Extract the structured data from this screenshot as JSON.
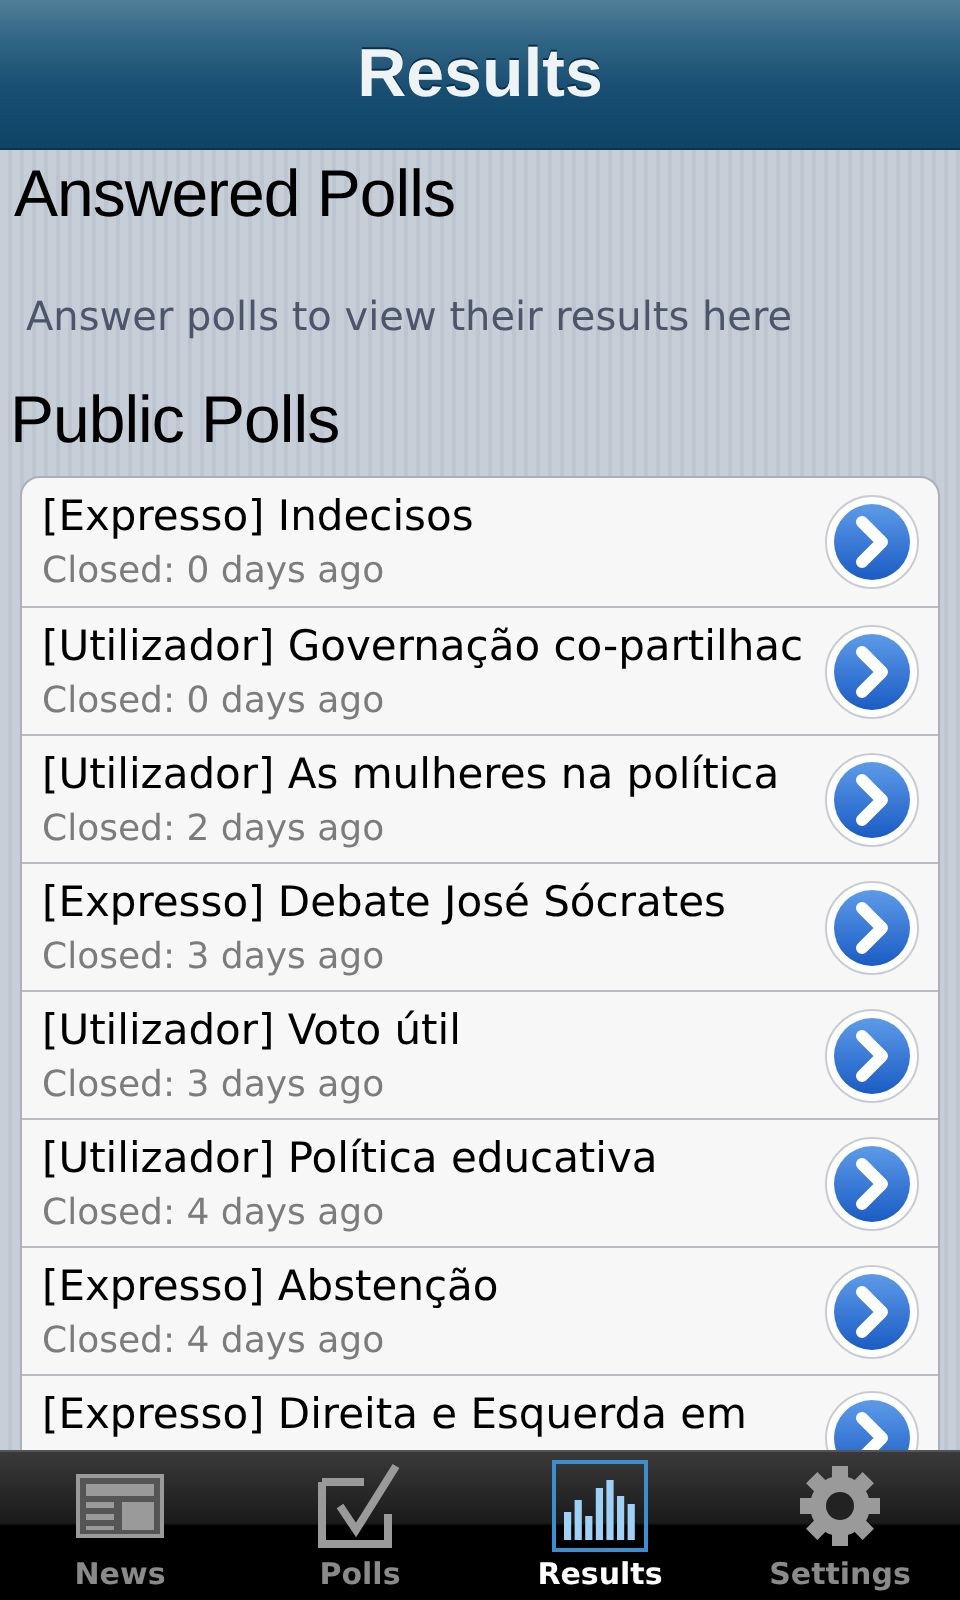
{
  "header": {
    "title": "Results"
  },
  "answered": {
    "heading": "Answered Polls",
    "message": "Answer polls to view their results here"
  },
  "public": {
    "heading": "Public Polls",
    "polls": [
      {
        "title": "[Expresso] Indecisos",
        "status": "Closed: 0 days ago"
      },
      {
        "title": "[Utilizador] Governação co-partilhac",
        "status": "Closed: 0 days ago"
      },
      {
        "title": "[Utilizador] As mulheres na política",
        "status": "Closed: 2 days ago"
      },
      {
        "title": "[Expresso] Debate José Sócrates",
        "status": "Closed: 3 days ago"
      },
      {
        "title": "[Utilizador] Voto útil",
        "status": "Closed: 3 days ago"
      },
      {
        "title": "[Utilizador] Política educativa",
        "status": "Closed: 4 days ago"
      },
      {
        "title": "[Expresso] Abstenção",
        "status": "Closed: 4 days ago"
      },
      {
        "title": "[Expresso] Direita e Esquerda em"
      }
    ]
  },
  "tabs": [
    {
      "label": "News",
      "kind": "news",
      "selected": false
    },
    {
      "label": "Polls",
      "kind": "polls",
      "selected": false
    },
    {
      "label": "Results",
      "kind": "results",
      "selected": true
    },
    {
      "label": "Settings",
      "kind": "settings",
      "selected": false
    }
  ]
}
